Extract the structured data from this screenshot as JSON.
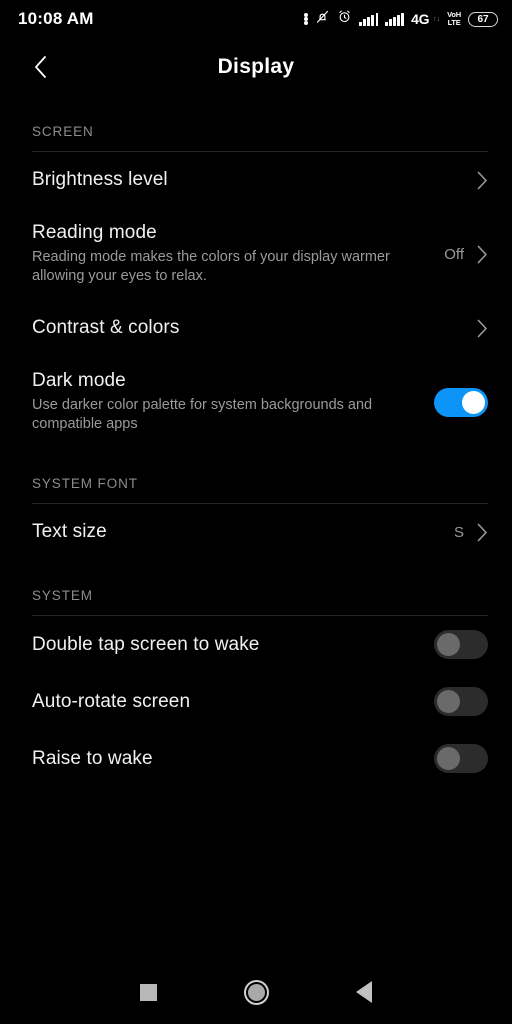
{
  "status_bar": {
    "time": "10:08 AM",
    "icons": [
      "more-dots-icon",
      "notification-muted-icon",
      "alarm-icon",
      "signal-bars-icon",
      "signal-bars-icon"
    ],
    "network": "4G",
    "data_arrows": "↑↓",
    "volte_top": "VoH",
    "volte_bottom": "LTE",
    "battery_level": "67"
  },
  "header": {
    "back_label": "‹",
    "title": "Display"
  },
  "sections": [
    {
      "label": "SCREEN"
    },
    {
      "label": "SYSTEM FONT"
    },
    {
      "label": "SYSTEM"
    }
  ],
  "rows": {
    "brightness": {
      "title": "Brightness level"
    },
    "reading_mode": {
      "title": "Reading mode",
      "subtitle": "Reading mode makes the colors of your display warmer allowing your eyes to relax.",
      "value": "Off"
    },
    "contrast": {
      "title": "Contrast & colors"
    },
    "dark_mode": {
      "title": "Dark mode",
      "subtitle": "Use darker color palette for system backgrounds and compatible apps",
      "state": "on"
    },
    "text_size": {
      "title": "Text size",
      "value": "S"
    },
    "double_tap": {
      "title": "Double tap screen to wake",
      "state": "off"
    },
    "auto_rotate": {
      "title": "Auto-rotate screen",
      "state": "off"
    },
    "raise_to_wake": {
      "title": "Raise to wake",
      "state": "off"
    }
  },
  "nav_bar": {
    "recents": "recents-square",
    "home": "home-circle",
    "back": "back-triangle"
  },
  "colors": {
    "background": "#000000",
    "toggle_on": "#0d94f7",
    "toggle_off_track": "#2c2c2c",
    "toggle_off_knob": "#6a6a6a",
    "title_text": "#f1f1f1",
    "secondary_text": "#9a9a9a",
    "section_label": "#8c8c8c",
    "divider": "#232323"
  }
}
